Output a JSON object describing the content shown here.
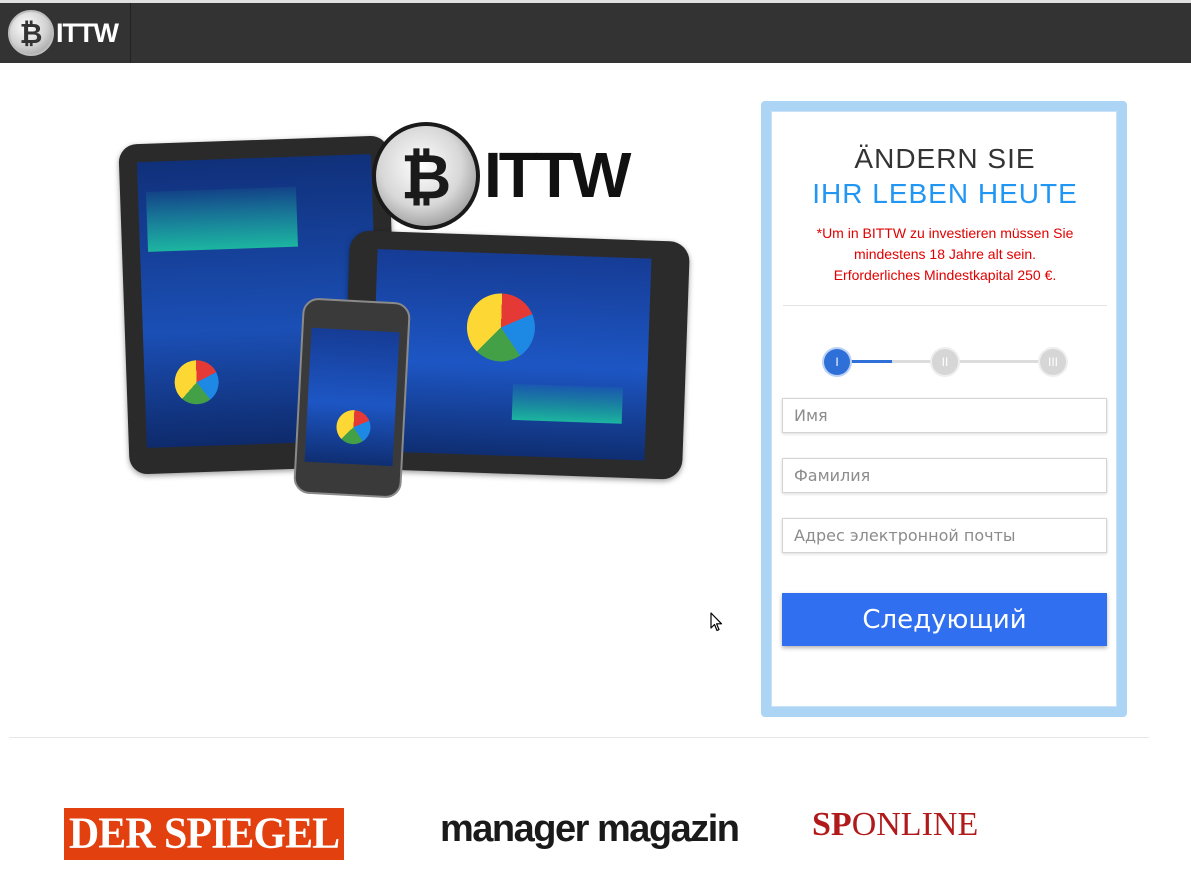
{
  "header": {
    "logo_symbol": "₿",
    "logo_text": "ITTW"
  },
  "hero": {
    "coin_symbol": "₿",
    "brand_text": "ITTW"
  },
  "form": {
    "title_line1": "ÄNDERN SIE",
    "title_line2": "IHR LEBEN HEUTE",
    "note_line1": "*Um in BITTW zu investieren müssen Sie",
    "note_line2": "mindestens 18 Jahre alt sein.",
    "note_line3": "Erforderliches Mindestkapital 250 €.",
    "steps": [
      "I",
      "II",
      "III"
    ],
    "first_name_placeholder": "Имя",
    "last_name_placeholder": "Фамилия",
    "email_placeholder": "Адрес электронной почты",
    "submit_label": "Следующий",
    "accent_color": "#2f6ff0",
    "title_color": "#2196f3",
    "note_color": "#e10000"
  },
  "press": {
    "spiegel": "DER SPIEGEL",
    "manager": "manager magazin",
    "sponline_prefix": "SP",
    "sponline_suffix": "ONLINE"
  }
}
